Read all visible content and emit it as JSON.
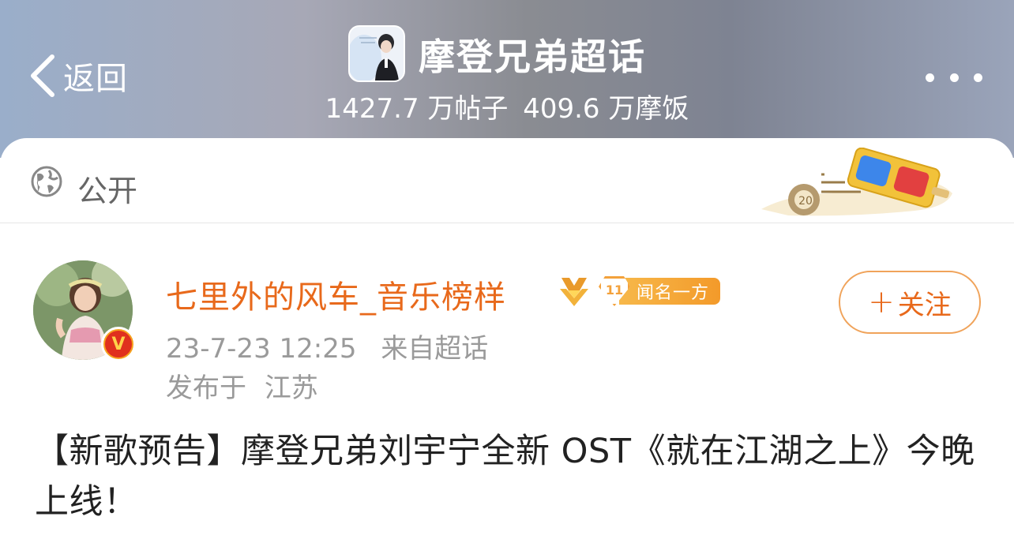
{
  "header": {
    "back_label": "返回",
    "topic_title": "摩登兄弟超话",
    "posts_count": "1427.7 万帖子",
    "fans_count": "409.6 万摩饭"
  },
  "visibility": {
    "label": "公开",
    "icon": "globe-icon"
  },
  "post": {
    "username": "七里外的风车_音乐榜样",
    "level_number": "11",
    "level_title": "闻名一方",
    "follow_label": "关注",
    "timestamp": "23-7-23 12:25",
    "source": "来自超话",
    "location_prefix": "发布于",
    "location": "江苏",
    "body": "【新歌预告】摩登兄弟刘宇宁全新 OST《就在江湖之上》今晚上线！"
  },
  "colors": {
    "accent": "#e8691b",
    "level_badge": "#f3a13b",
    "meta_text": "#9a9a9a"
  }
}
